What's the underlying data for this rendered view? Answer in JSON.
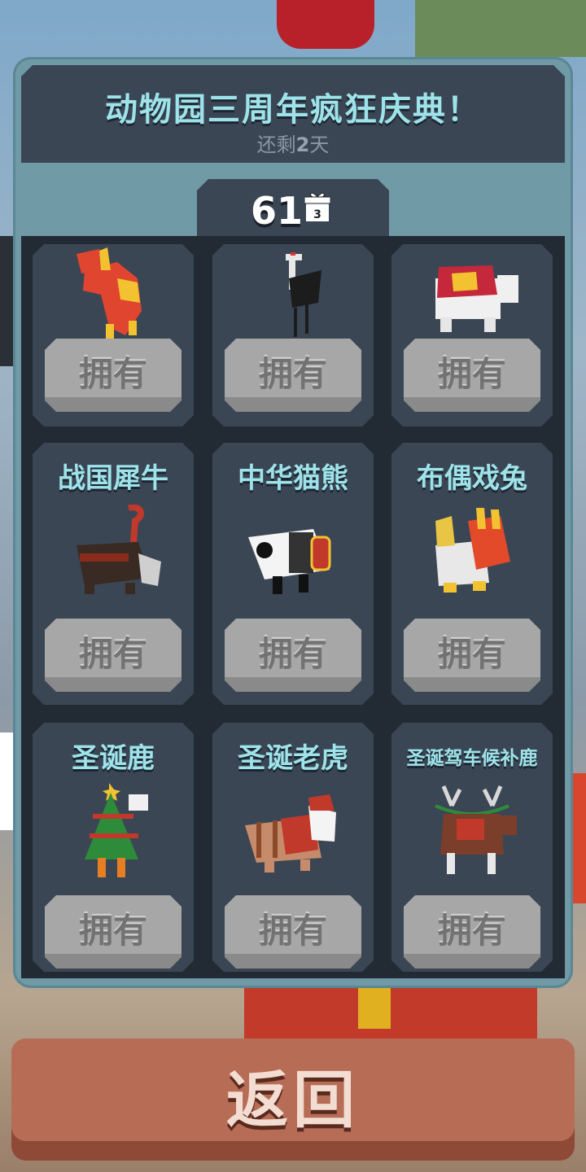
{
  "event": {
    "title": "动物园三周年疯狂庆典！",
    "remaining_prefix": "还剩",
    "remaining_days": "2",
    "remaining_suffix": "天"
  },
  "counter": {
    "value": "61",
    "gift_icon": "gift-box-icon",
    "gift_badge": "3"
  },
  "cards": [
    {
      "name": "",
      "animal_icon": "red-horse-icon",
      "button": "拥有"
    },
    {
      "name": "",
      "animal_icon": "crane-icon",
      "button": "拥有"
    },
    {
      "name": "",
      "animal_icon": "white-elephant-icon",
      "button": "拥有"
    },
    {
      "name": "战国犀牛",
      "animal_icon": "rhino-icon",
      "button": "拥有"
    },
    {
      "name": "中华猫熊",
      "animal_icon": "panda-icon",
      "button": "拥有"
    },
    {
      "name": "布偶戏兔",
      "animal_icon": "puppet-rabbit-icon",
      "button": "拥有"
    },
    {
      "name": "圣诞鹿",
      "animal_icon": "christmas-deer-icon",
      "button": "拥有"
    },
    {
      "name": "圣诞老虎",
      "animal_icon": "santa-tiger-icon",
      "button": "拥有"
    },
    {
      "name": "圣诞驾车候补鹿",
      "animal_icon": "reindeer-icon",
      "button": "拥有"
    }
  ],
  "back_button": "返回",
  "colors": {
    "panel": "#6f9aa6",
    "card": "#3b4655",
    "title_text": "#9ee3ea",
    "owned_button": "#a7a7a7",
    "back_button": "#b76c56"
  }
}
